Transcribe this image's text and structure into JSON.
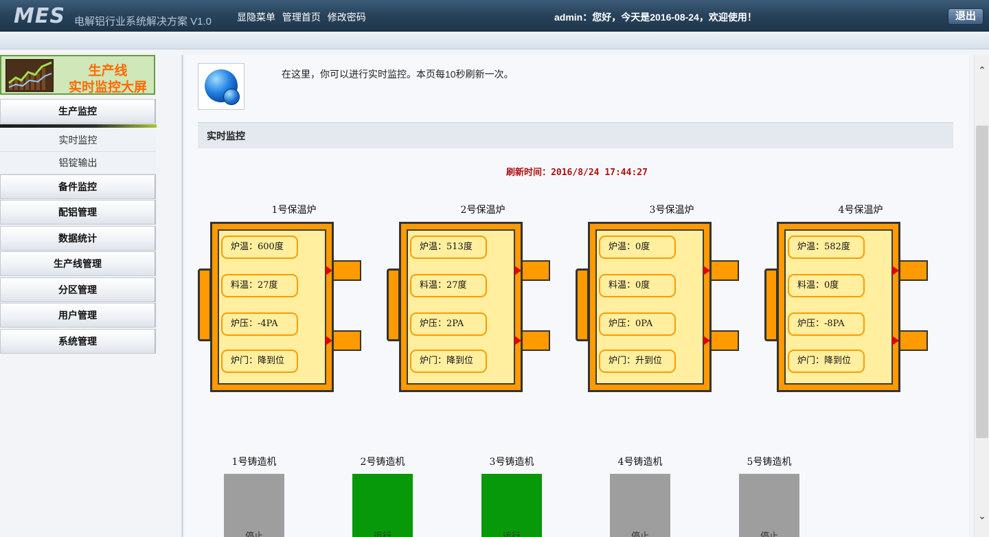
{
  "header": {
    "logo": "MES",
    "subtitle": "电解铝行业系统解决方案 V1.0",
    "nav": [
      "显隐菜单",
      "管理首页",
      "修改密码"
    ],
    "greeting": "admin：您好，今天是2016-08-24，欢迎使用！",
    "logout": "退出"
  },
  "sidebar": {
    "banner_line1": "生产线",
    "banner_line2": "实时监控大屏",
    "menu": [
      {
        "label": "生产监控"
      },
      {
        "label": "实时监控"
      },
      {
        "label": "铝锭输出"
      },
      {
        "label": "备件监控"
      },
      {
        "label": "配铝管理"
      },
      {
        "label": "数据统计"
      },
      {
        "label": "生产线管理"
      },
      {
        "label": "分区管理"
      },
      {
        "label": "用户管理"
      },
      {
        "label": "系统管理"
      }
    ]
  },
  "main": {
    "intro": "在这里，你可以进行实时监控。本页每10秒刷新一次。",
    "section_title": "实时监控",
    "refresh_label": "刷新时间：",
    "refresh_time": "2016/8/24 17:44:27",
    "furnaces": [
      {
        "name": "1号保温炉",
        "furnace_temp": "炉温：600度",
        "material_temp": "料温：27度",
        "pressure": "炉压：-4PA",
        "door": "炉门：降到位"
      },
      {
        "name": "2号保温炉",
        "furnace_temp": "炉温：513度",
        "material_temp": "料温：27度",
        "pressure": "炉压：2PA",
        "door": "炉门：降到位"
      },
      {
        "name": "3号保温炉",
        "furnace_temp": "炉温：0度",
        "material_temp": "料温：0度",
        "pressure": "炉压：0PA",
        "door": "炉门：升到位"
      },
      {
        "name": "4号保温炉",
        "furnace_temp": "炉温：582度",
        "material_temp": "料温：0度",
        "pressure": "炉压：-8PA",
        "door": "炉门：降到位"
      }
    ],
    "casters": [
      {
        "name": "1号铸造机",
        "status": "停止",
        "state": "stop",
        "color": "#9e9e9e"
      },
      {
        "name": "2号铸造机",
        "status": "运行",
        "state": "run",
        "color": "#07990a"
      },
      {
        "name": "3号铸造机",
        "status": "运行",
        "state": "run",
        "color": "#07990a"
      },
      {
        "name": "4号铸造机",
        "status": "停止",
        "state": "stop",
        "color": "#9e9e9e"
      },
      {
        "name": "5号铸造机",
        "status": "停止",
        "state": "stop",
        "color": "#9e9e9e"
      }
    ]
  },
  "colors": {
    "furnace_orange": "#ff9a00",
    "furnace_inner": "#ffef9f",
    "refresh_red": "#b01010",
    "running_green": "#07990a",
    "stopped_gray": "#9e9e9e"
  }
}
